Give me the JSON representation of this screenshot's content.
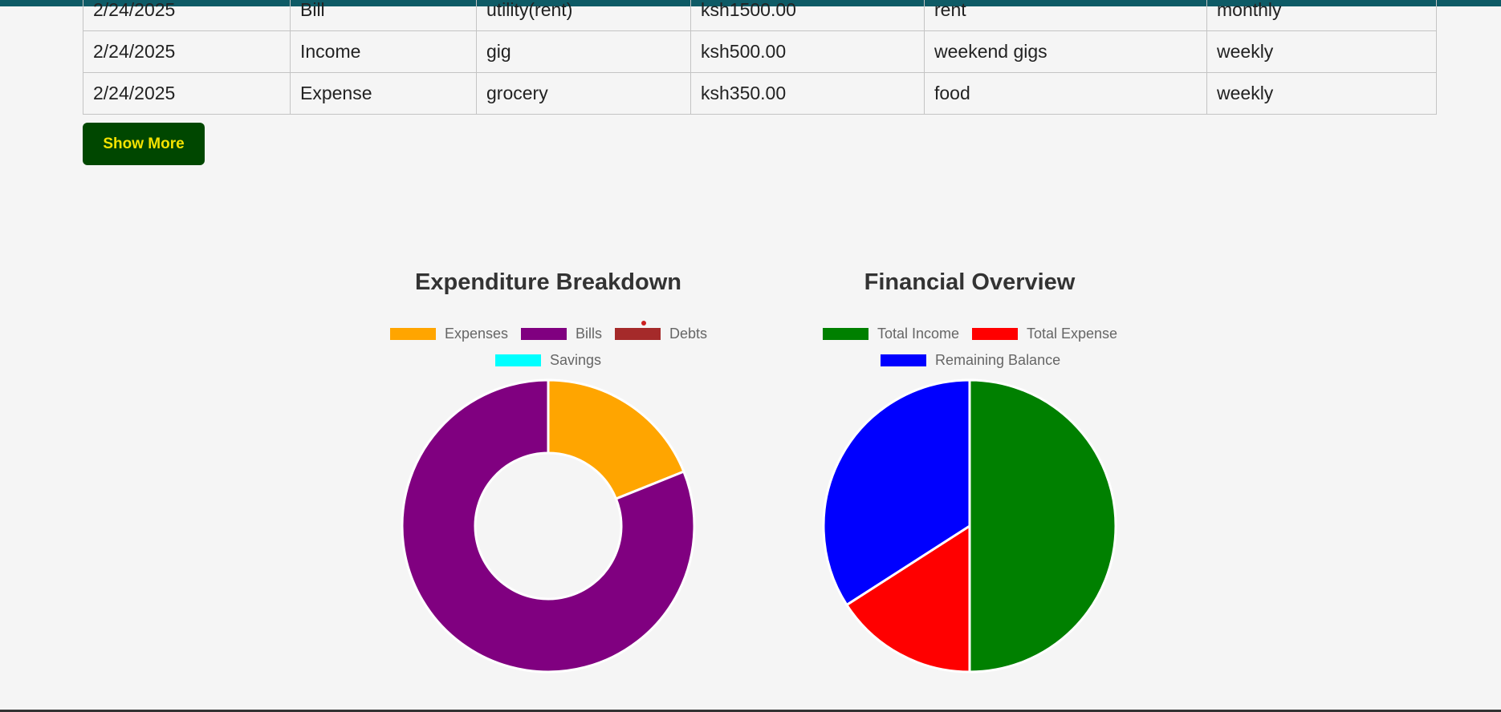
{
  "transactions": [
    {
      "date": "2/24/2025",
      "type": "Bill",
      "category": "utility(rent)",
      "amount": "ksh1500.00",
      "description": "rent",
      "frequency": "monthly"
    },
    {
      "date": "2/24/2025",
      "type": "Income",
      "category": "gig",
      "amount": "ksh500.00",
      "description": "weekend gigs",
      "frequency": "weekly"
    },
    {
      "date": "2/24/2025",
      "type": "Expense",
      "category": "grocery",
      "amount": "ksh350.00",
      "description": "food",
      "frequency": "weekly"
    }
  ],
  "show_more_label": "Show More",
  "charts": {
    "expenditure": {
      "title": "Expenditure Breakdown",
      "legend": [
        {
          "label": "Expenses",
          "color": "#ffa500"
        },
        {
          "label": "Bills",
          "color": "#800080"
        },
        {
          "label": "Debts",
          "color": "#a52a2a"
        },
        {
          "label": "Savings",
          "color": "#00ffff"
        }
      ]
    },
    "overview": {
      "title": "Financial Overview",
      "legend": [
        {
          "label": "Total Income",
          "color": "#008000"
        },
        {
          "label": "Total Expense",
          "color": "#ff0000"
        },
        {
          "label": "Remaining Balance",
          "color": "#0000ff"
        }
      ]
    }
  },
  "chart_data": [
    {
      "type": "pie",
      "variant": "doughnut",
      "title": "Expenditure Breakdown",
      "labels": [
        "Expenses",
        "Bills",
        "Debts",
        "Savings"
      ],
      "values": [
        350,
        1500,
        0,
        0
      ],
      "colors": [
        "#ffa500",
        "#800080",
        "#a52a2a",
        "#00ffff"
      ]
    },
    {
      "type": "pie",
      "title": "Financial Overview",
      "labels": [
        "Total Income",
        "Total Expense",
        "Remaining Balance"
      ],
      "values": [
        2200,
        700,
        1500
      ],
      "colors": [
        "#008000",
        "#ff0000",
        "#0000ff"
      ]
    }
  ]
}
